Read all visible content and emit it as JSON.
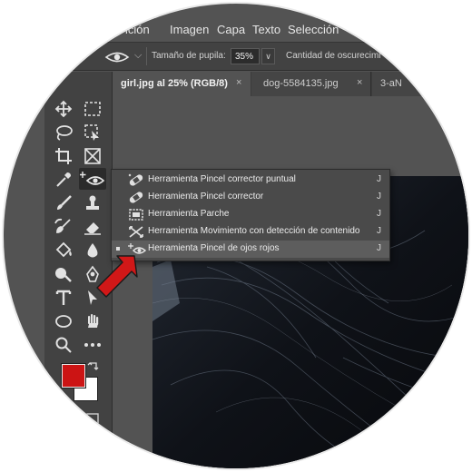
{
  "menubar": {
    "items": [
      "ición",
      "Imagen",
      "Capa",
      "Texto",
      "Selección"
    ]
  },
  "options_bar": {
    "tool_icon": "red-eye-icon",
    "pupil_size_label": "Tamaño de pupila:",
    "pupil_size_value": "35%",
    "darken_amount_label": "Cantidad de oscurecimi"
  },
  "tabs": [
    {
      "label": "girl.jpg al 25% (RGB/8)",
      "close": "×",
      "active": true
    },
    {
      "label": "dog-5584135.jpg",
      "close": "×",
      "active": false
    },
    {
      "label": "3-aN",
      "active": false
    }
  ],
  "flyout": {
    "items": [
      {
        "label": "Herramienta Pincel corrector puntual",
        "shortcut": "J",
        "icon": "spot-healing-brush-icon",
        "active": false
      },
      {
        "label": "Herramienta Pincel corrector",
        "shortcut": "J",
        "icon": "healing-brush-icon",
        "active": false
      },
      {
        "label": "Herramienta Parche",
        "shortcut": "J",
        "icon": "patch-icon",
        "active": false
      },
      {
        "label": "Herramienta Movimiento con detección de contenido",
        "shortcut": "J",
        "icon": "content-aware-move-icon",
        "active": false
      },
      {
        "label": "Herramienta Pincel de ojos rojos",
        "shortcut": "J",
        "icon": "red-eye-icon",
        "active": true
      }
    ]
  },
  "toolbar": {
    "tools": [
      "move-icon",
      "marquee-icon",
      "lasso-icon",
      "object-selection-icon",
      "crop-icon",
      "frame-icon",
      "eyedropper-icon",
      "red-eye-icon",
      "brush-icon",
      "stamp-icon",
      "history-brush-icon",
      "eraser-icon",
      "paint-bucket-icon",
      "blur-icon",
      "dodge-icon",
      "pen-icon",
      "type-icon",
      "path-selection-icon",
      "ellipse-icon",
      "hand-icon",
      "zoom-icon",
      "more-icon"
    ]
  },
  "colors": {
    "foreground": "#cc1414",
    "background": "#ffffff",
    "arrow": "#d11818"
  }
}
